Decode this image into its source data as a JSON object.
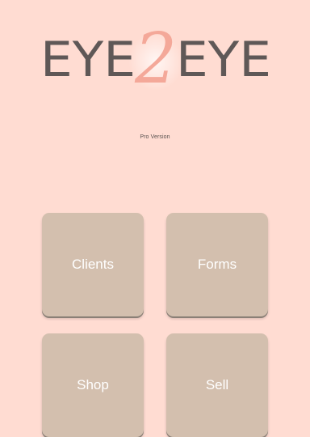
{
  "logo": {
    "text_left": "EYE",
    "numeral": "2",
    "text_right": "EYE",
    "text_color": "#5f5857",
    "numeral_color": "#f4a899"
  },
  "version_label": "Pro Version",
  "colors": {
    "background": "#ffdcd2",
    "tile": "#d3bfae",
    "tile_text": "#ffffff"
  },
  "tiles": [
    {
      "label": "Clients"
    },
    {
      "label": "Forms"
    },
    {
      "label": "Shop"
    },
    {
      "label": "Sell"
    }
  ]
}
